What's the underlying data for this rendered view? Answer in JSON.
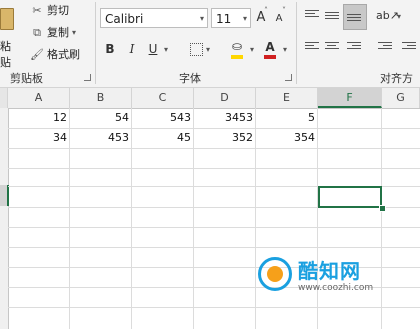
{
  "ribbon": {
    "clipboard": {
      "paste_label": "粘贴",
      "cut_label": "剪切",
      "copy_label": "复制",
      "format_painter_label": "格式刷",
      "group_label": "剪贴板"
    },
    "font": {
      "font_name": "Calibri",
      "font_size": "11",
      "bold_label": "B",
      "italic_label": "I",
      "underline_label": "U",
      "grow_label": "A",
      "shrink_label": "A",
      "font_color_label": "A",
      "group_label": "字体",
      "fill_color": "#ffd700",
      "font_color": "#d02020"
    },
    "alignment": {
      "group_label": "对齐方式"
    }
  },
  "sheet": {
    "columns": [
      "A",
      "B",
      "C",
      "D",
      "E",
      "F",
      "G"
    ],
    "selected_column": "F",
    "rows": [
      [
        "12",
        "54",
        "543",
        "3453",
        "5"
      ],
      [
        "34",
        "453",
        "45",
        "352",
        "354"
      ]
    ],
    "accent_color": "#217346"
  },
  "watermark": {
    "title": "酷知网",
    "url": "www.coozhi.com"
  }
}
